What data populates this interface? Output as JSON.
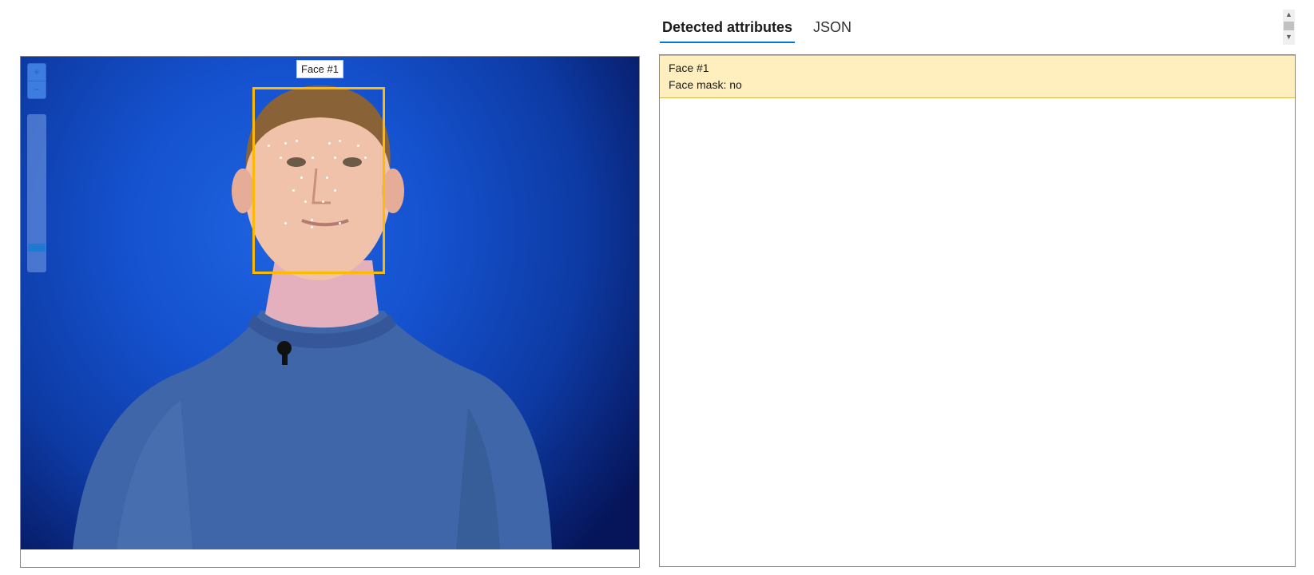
{
  "tabs": [
    {
      "label": "Detected attributes",
      "active": true
    },
    {
      "label": "JSON",
      "active": false
    }
  ],
  "viewer": {
    "zoom_in_icon": "plus-icon",
    "zoom_out_icon": "minus-icon",
    "zoom_level_fraction": 0.08,
    "face_tag": "Face #1",
    "box_color": "#ffb900"
  },
  "attributes": [
    {
      "title": "Face #1",
      "detail": "Face mask: no"
    }
  ],
  "colors": {
    "accent": "#0078d4",
    "highlight": "#ffefbe",
    "background_blue": "#1552cf"
  }
}
